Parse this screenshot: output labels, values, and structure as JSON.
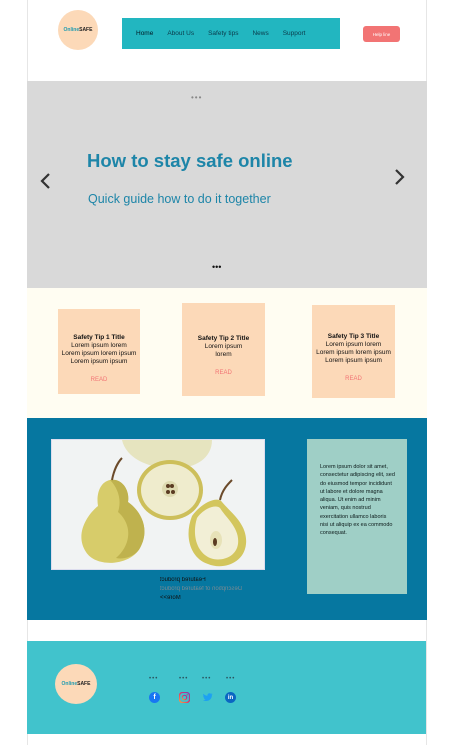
{
  "header": {
    "logo": {
      "part1": "Online",
      "part2": "SAFE"
    },
    "nav": [
      "Home",
      "About Us",
      "Safety tips",
      "News",
      "Support"
    ],
    "help_button": "Help line"
  },
  "hero": {
    "title": "How to stay safe online",
    "subtitle": "Quick guide how to do it together",
    "dots_top": "•••",
    "dots_bottom": "•••",
    "prev_icon": "‹",
    "next_icon": "›"
  },
  "tips": [
    {
      "title": "Safety Tip 1 Title",
      "lines": [
        "Lorem ipsum lorem",
        "Lorem ipsum lorem ipsum",
        "Lorem ipsum ipsum"
      ],
      "action": "READ"
    },
    {
      "title": "Safety Tip 2 Title",
      "lines": [
        "Lorem ipsum",
        "lorem"
      ],
      "action": "READ"
    },
    {
      "title": "Safety Tip 3 Title",
      "lines": [
        "Lorem ipsum lorem",
        "Lorem ipsum lorem ipsum",
        "Lorem ipsum ipsum"
      ],
      "action": "READ"
    }
  ],
  "featured": {
    "caption_title": "Featured product",
    "caption_desc": "Description of featured product",
    "caption_cta": "More>>",
    "body": "Lorem ipsum dolor sit amet, consectetur adipiscing elit, sed do eiusmod tempor incididunt ut labore et dolore magna aliqua. Ut enim ad minim veniam, quis nostrud exercitation ullamco laboris nisi ut aliquip ex ea commodo consequat."
  },
  "footer": {
    "logo": {
      "part1": "Online",
      "part2": "SAFE"
    },
    "dots": [
      "•••",
      "•••",
      "•••",
      "•••"
    ],
    "social_icons": [
      "facebook-icon",
      "instagram-icon",
      "twitter-icon",
      "linkedin-icon"
    ]
  },
  "colors": {
    "nav": "#22b6c0",
    "accent": "#f27474",
    "hero_text": "#1d85a8",
    "featured_bg": "#0677a0",
    "footer_bg": "#41c3cc",
    "peach": "#fcd9b8"
  }
}
